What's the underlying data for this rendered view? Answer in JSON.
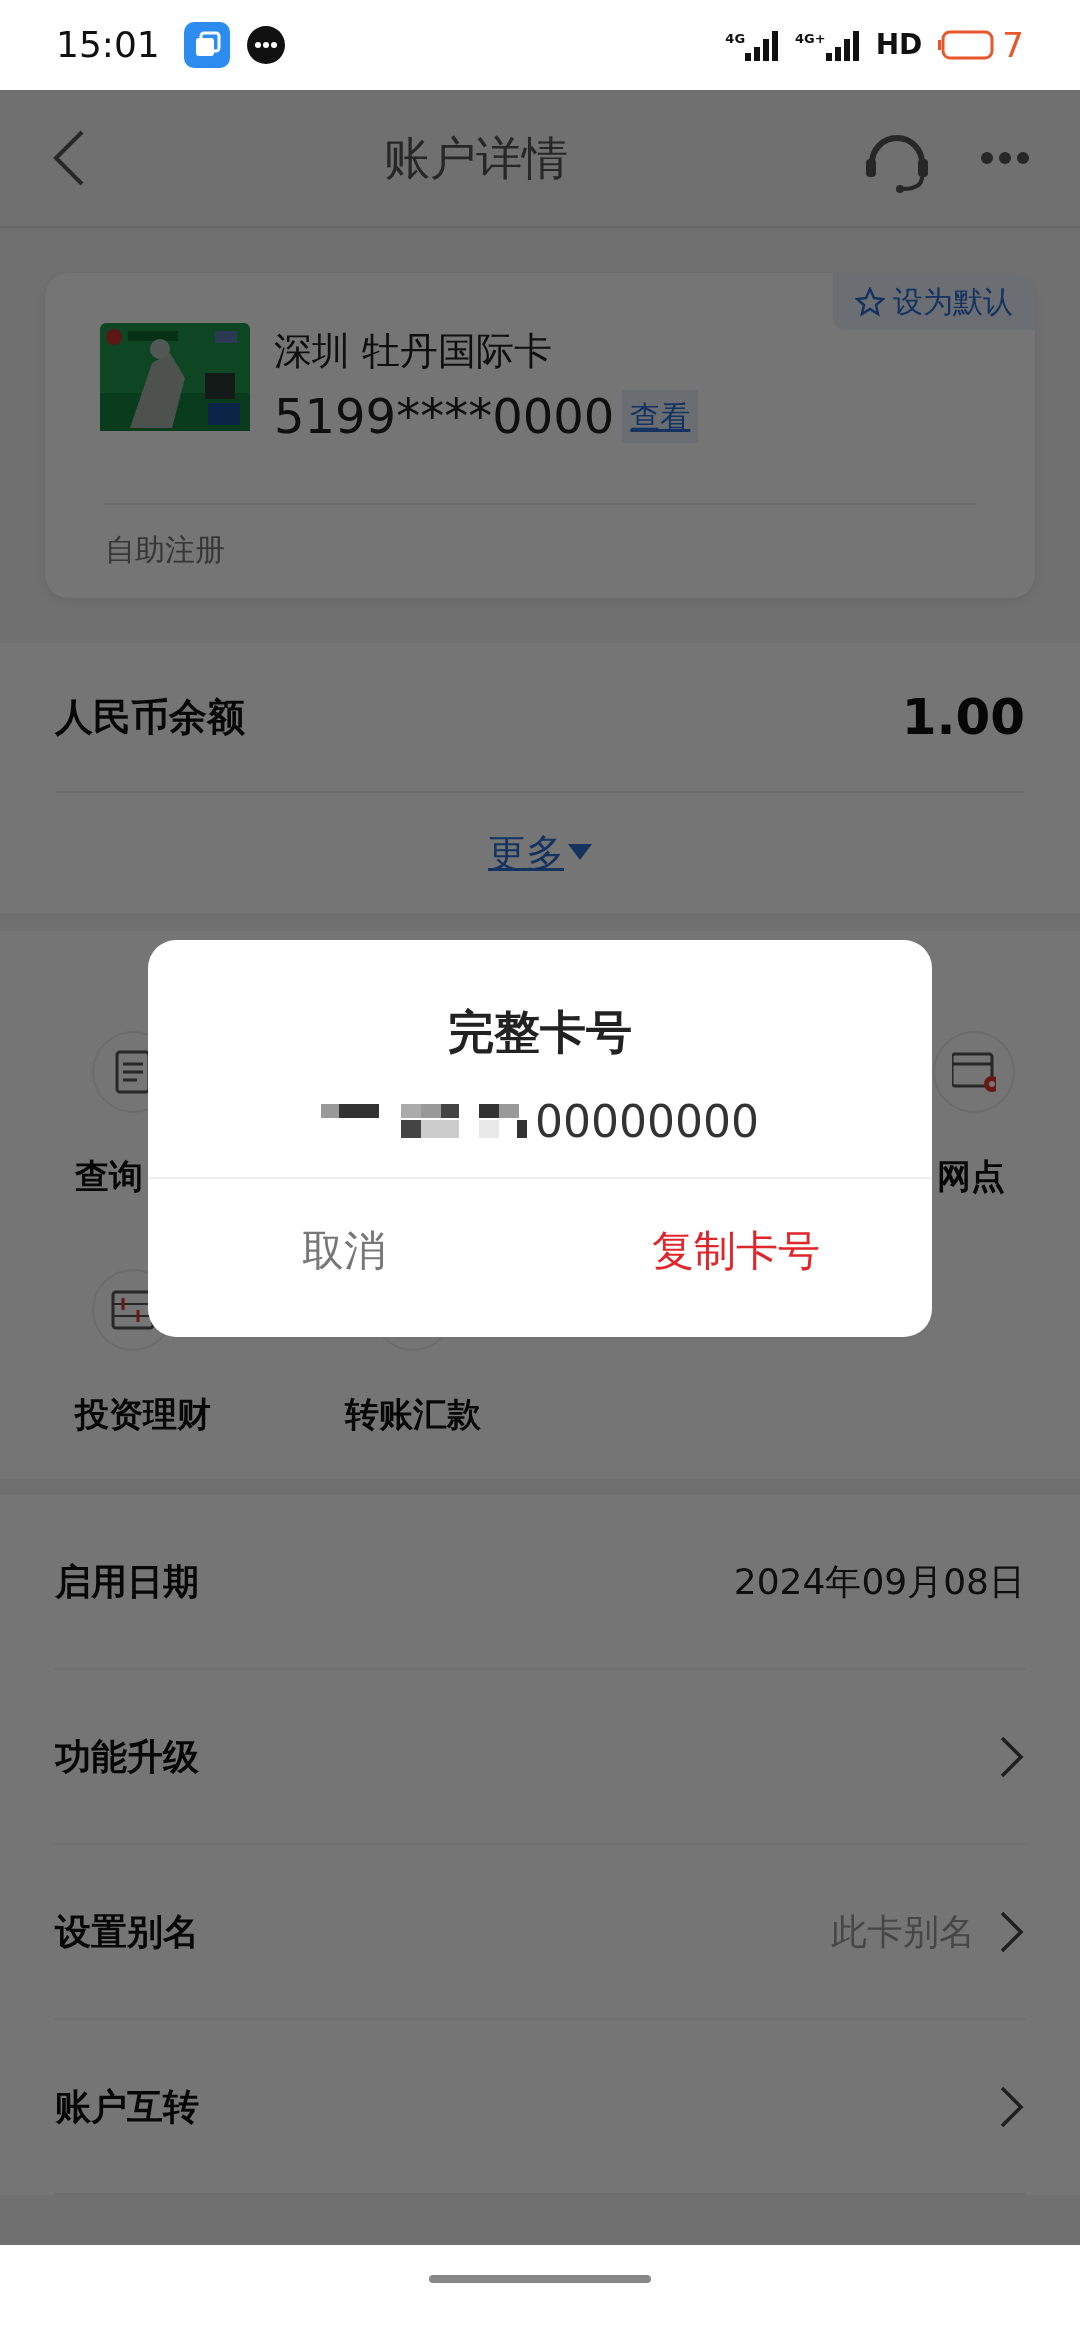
{
  "status_bar": {
    "time": "15:01",
    "networks": [
      "4G",
      "4G+"
    ],
    "hd": "HD",
    "battery": "7"
  },
  "header": {
    "title": "账户详情"
  },
  "card": {
    "name": "深圳 牡丹国际卡",
    "number": "5199****0000",
    "view_button": "查看",
    "default_button": "设为默认",
    "footer": "自助注册"
  },
  "balance": {
    "label": "人民币余额",
    "value": "1.00",
    "more_toggle": "更多"
  },
  "shortcut_rows": [
    [
      {
        "label": "查询"
      },
      null,
      null,
      {
        "label": "网点"
      }
    ],
    [
      {
        "label": "投资理财"
      },
      {
        "label": "转账汇款"
      }
    ]
  ],
  "details": [
    {
      "label": "启用日期",
      "value": "2024年09月08日",
      "kind": "text"
    },
    {
      "label": "功能升级",
      "kind": "link"
    },
    {
      "label": "设置别名",
      "value": "此卡别名",
      "kind": "link"
    },
    {
      "label": "账户互转",
      "kind": "link"
    }
  ],
  "dialog": {
    "title": "完整卡号",
    "number": "00000000",
    "buttons": [
      {
        "label": "取消",
        "kind": "cancel"
      },
      {
        "label": "复制卡号",
        "kind": "confirm"
      }
    ]
  }
}
